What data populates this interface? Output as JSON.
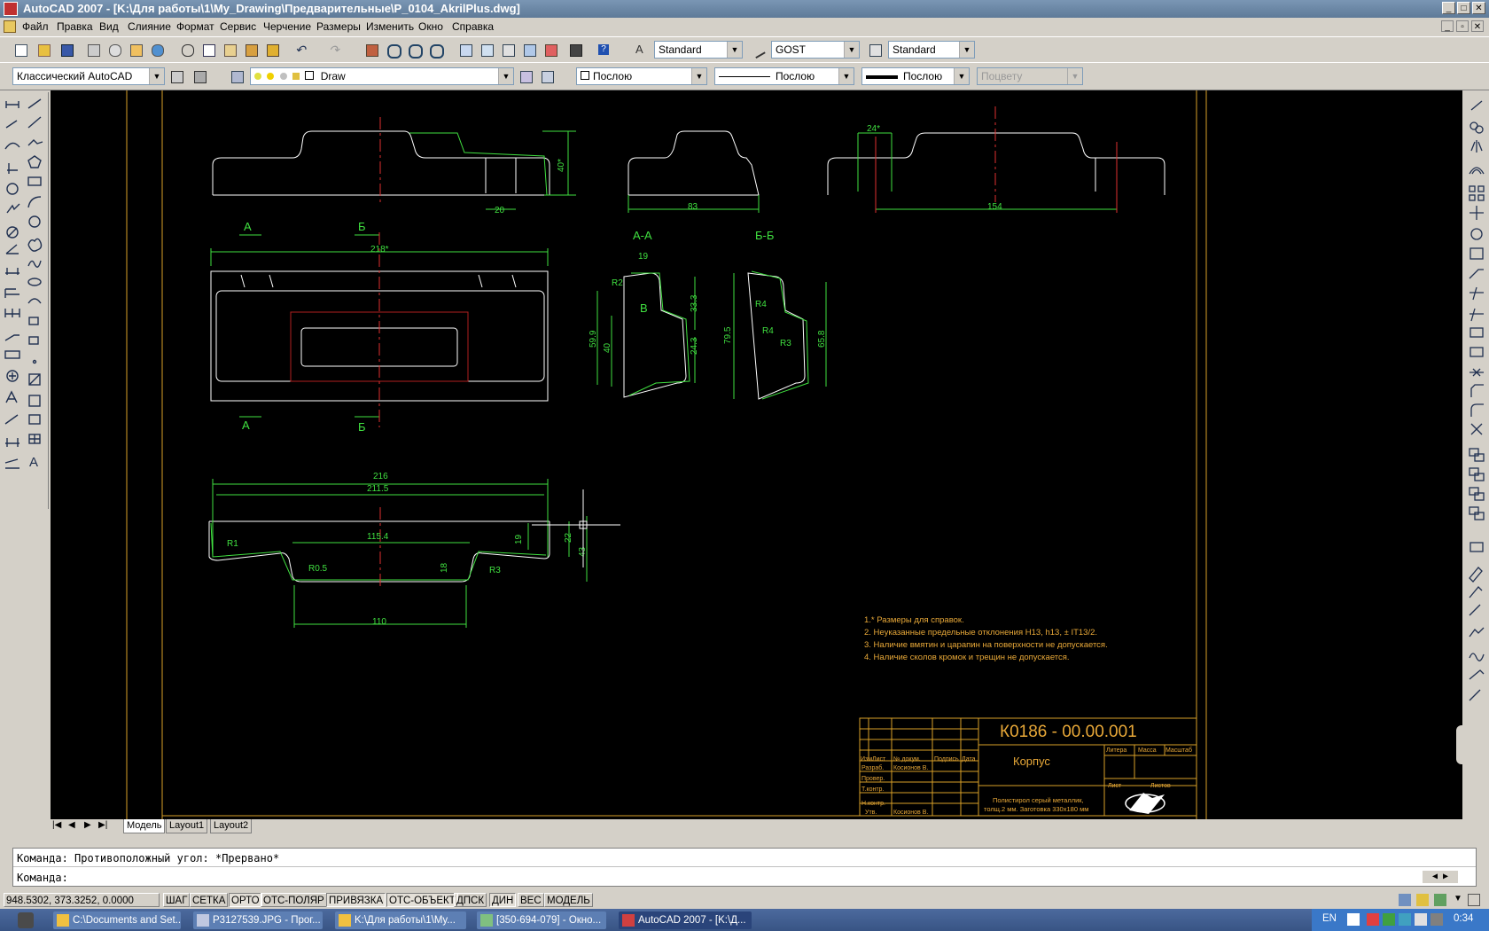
{
  "window": {
    "title": "AutoCAD 2007 - [K:\\Для работы\\1\\My_Drawing\\Предварительные\\P_0104_AkrilPlus.dwg]"
  },
  "menu": [
    "Файл",
    "Правка",
    "Вид",
    "Слияние",
    "Формат",
    "Сервис",
    "Черчение",
    "Размеры",
    "Изменить",
    "Окно",
    "Справка"
  ],
  "toolbar": {
    "text_style": "Standard",
    "dim_style": "GOST",
    "table_style": "Standard",
    "workspace": "Классический AutoCAD",
    "layer": "Draw",
    "color": "Послою",
    "linetype": "Послою",
    "lineweight": "Послою",
    "plotstyle": "Поцвету"
  },
  "tabs": [
    "Модель",
    "Layout1",
    "Layout2"
  ],
  "command": {
    "history": "Команда: Противоположный угол: *Прервано*",
    "prompt": "Команда:"
  },
  "status": {
    "coords": "948.5302, 373.3252, 0.0000",
    "buttons": [
      "ШАГ",
      "СЕТКА",
      "ОРТО",
      "ОТС-ПОЛЯР",
      "ПРИВЯЗКА",
      "ОТС-ОБЪЕКТ",
      "ДПСК",
      "ДИН",
      "ВЕС",
      "МОДЕЛЬ"
    ]
  },
  "taskbar": {
    "items": [
      "C:\\Documents and Set...",
      "P3127539.JPG - Прог...",
      "K:\\Для работы\\1\\My...",
      "[350-694-079] - Окно...",
      "AutoCAD 2007 - [K:\\Д..."
    ],
    "lang": "EN",
    "clock": "0:34"
  },
  "drawing": {
    "section_aa": "А-А",
    "section_bb": "Б-Б",
    "lbl_a": "А",
    "lbl_b": "Б",
    "lbl_v": "В",
    "dims": {
      "d40": "40*",
      "d20": "20",
      "d83": "83",
      "d24": "24*",
      "d154": "154",
      "d218": "218*",
      "d19": "19",
      "d333": "33.3",
      "d599": "59.9",
      "d40b": "40",
      "d243": "24.3",
      "dR2": "R2",
      "d795": "79.5",
      "d658": "65.8",
      "dR4": "R4",
      "dR4b": "R4",
      "dR3": "R3",
      "d216": "216",
      "d2115": "211.5",
      "d1154": "115.4",
      "dR1": "R1",
      "dR05": "R0.5",
      "d18": "18",
      "dR3b": "R3",
      "d19b": "19",
      "d22": "22",
      "d43": "43",
      "d110": "110"
    },
    "notes": [
      "1.* Размеры для справок.",
      "2. Неуказанные предельные отклонения H13, h13, ± IT13/2.",
      "3. Наличие вмятин и царапин на поверхности не допускается.",
      "4. Наличие сколов кромок и трещин не допускается."
    ],
    "titleblock": {
      "code": "К0186 - 00.00.001",
      "name": "Корпус",
      "material_1": "Полистирол серый металлик,",
      "material_2": "толщ.2 мм. Заготовка 330х180 мм",
      "h_izm": "Изм.",
      "h_list": "Лист",
      "h_doc": "№ докум.",
      "h_sign": "Подпись",
      "h_date": "Дата",
      "razrab": "Разраб.",
      "razrab_name": "Косионов В.",
      "prover": "Провер.",
      "tkontr": "Т.контр.",
      "nkontr": "Н.контр.",
      "utv": "Утв.",
      "utv_name": "Косионов В.",
      "litera": "Литера",
      "massa": "Масса",
      "masshtab": "Масштаб",
      "list": "Лист",
      "listov": "Листов"
    }
  }
}
